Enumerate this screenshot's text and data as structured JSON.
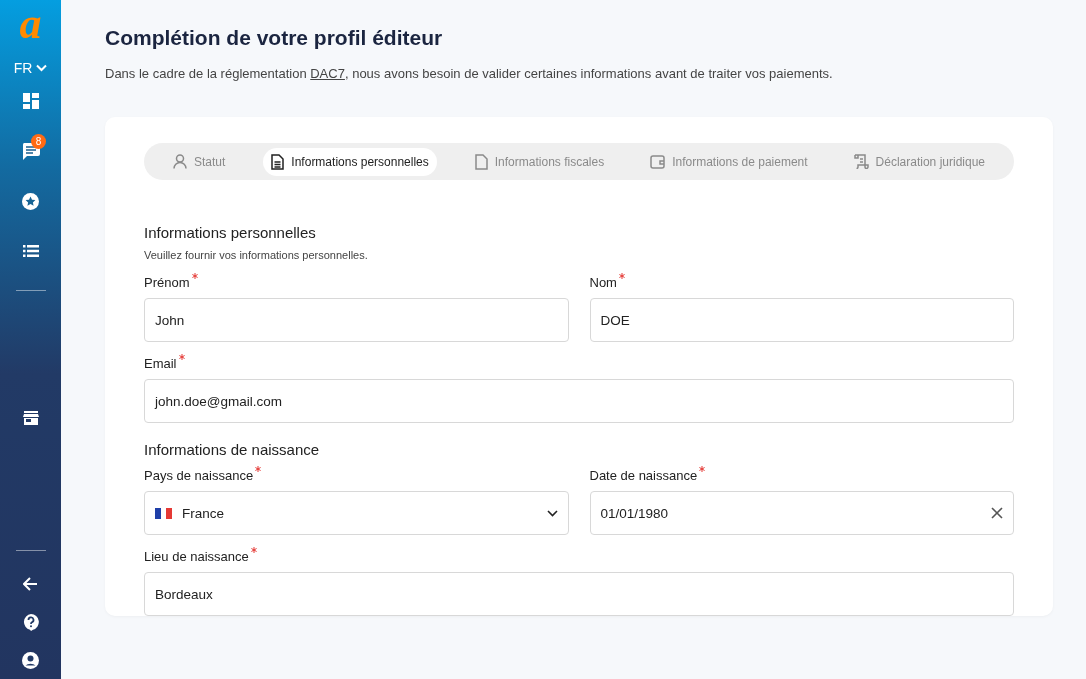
{
  "sidebar": {
    "logo": "a",
    "language": "FR",
    "chat_badge": "8"
  },
  "header": {
    "title": "Complétion de votre profil éditeur",
    "intro_before": "Dans le cadre de la réglementation",
    "intro_link": "DAC7",
    "intro_after": ", nous avons besoin de valider certaines informations avant de traiter vos paiements."
  },
  "steps": [
    {
      "label": "Statut",
      "selected": false
    },
    {
      "label": "Informations personnelles",
      "selected": true
    },
    {
      "label": "Informations fiscales",
      "selected": false
    },
    {
      "label": "Informations de paiement",
      "selected": false
    },
    {
      "label": "Déclaration juridique",
      "selected": false
    }
  ],
  "sections": [
    {
      "title": "Informations personnelles",
      "subtitle": "Veuillez fournir vos informations personnelles.",
      "rows": [
        [
          {
            "label": "Prénom",
            "required": true,
            "kind": "text",
            "value": "John"
          },
          {
            "label": "Nom",
            "required": true,
            "kind": "text",
            "value": "DOE"
          }
        ],
        [
          {
            "label": "Email",
            "required": true,
            "kind": "text",
            "value": "john.doe@gmail.com"
          }
        ]
      ]
    },
    {
      "title": "Informations de naissance",
      "rows": [
        [
          {
            "label": "Pays de naissance",
            "required": true,
            "kind": "select",
            "value": "France"
          },
          {
            "label": "Date de naissance",
            "required": true,
            "kind": "date",
            "value": "01/01/1980"
          }
        ],
        [
          {
            "label": "Lieu de naissance",
            "required": true,
            "kind": "text",
            "value": "Bordeaux"
          }
        ]
      ]
    }
  ]
}
